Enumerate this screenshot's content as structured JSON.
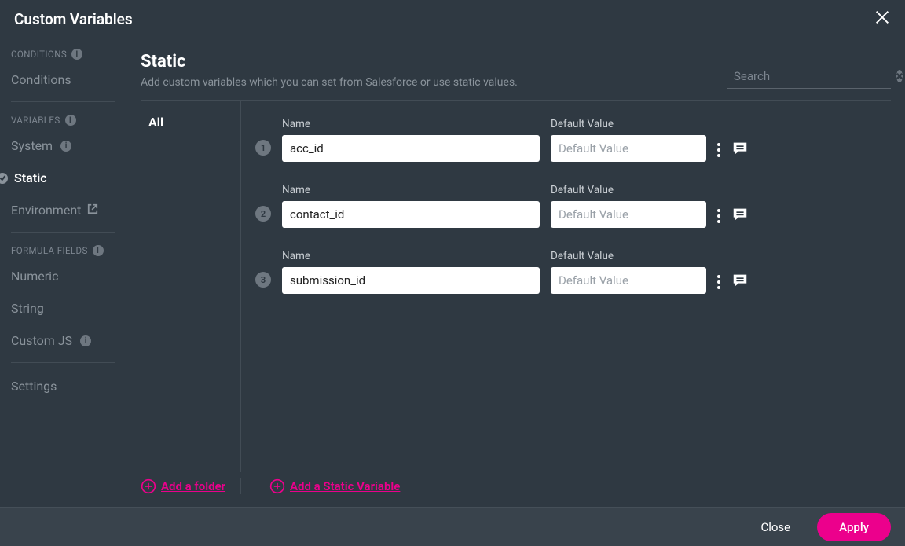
{
  "titlebar": {
    "title": "Custom Variables"
  },
  "sidebar": {
    "sections": {
      "conditions": {
        "header": "CONDITIONS",
        "items": [
          {
            "label": "Conditions",
            "has_info": false
          }
        ]
      },
      "variables": {
        "header": "VARIABLES",
        "items": [
          {
            "label": "System",
            "has_info": true
          },
          {
            "label": "Static",
            "active": true
          },
          {
            "label": "Environment",
            "external": true
          }
        ]
      },
      "formula": {
        "header": "FORMULA FIELDS",
        "items": [
          {
            "label": "Numeric"
          },
          {
            "label": "String"
          },
          {
            "label": "Custom JS",
            "has_info": true
          }
        ]
      },
      "settings_label": "Settings"
    }
  },
  "main": {
    "title": "Static",
    "subtitle": "Add custom variables which you can set from Salesforce or use static values.",
    "search_placeholder": "Search"
  },
  "folders": {
    "all_label": "All"
  },
  "labels": {
    "name": "Name",
    "default_value": "Default Value",
    "default_value_placeholder": "Default Value"
  },
  "variables": [
    {
      "index": "1",
      "name": "acc_id",
      "value": ""
    },
    {
      "index": "2",
      "name": "contact_id",
      "value": ""
    },
    {
      "index": "3",
      "name": "submission_id",
      "value": ""
    }
  ],
  "actions": {
    "add_folder": "Add a folder",
    "add_variable": "Add a Static Variable",
    "close": "Close",
    "apply": "Apply"
  }
}
